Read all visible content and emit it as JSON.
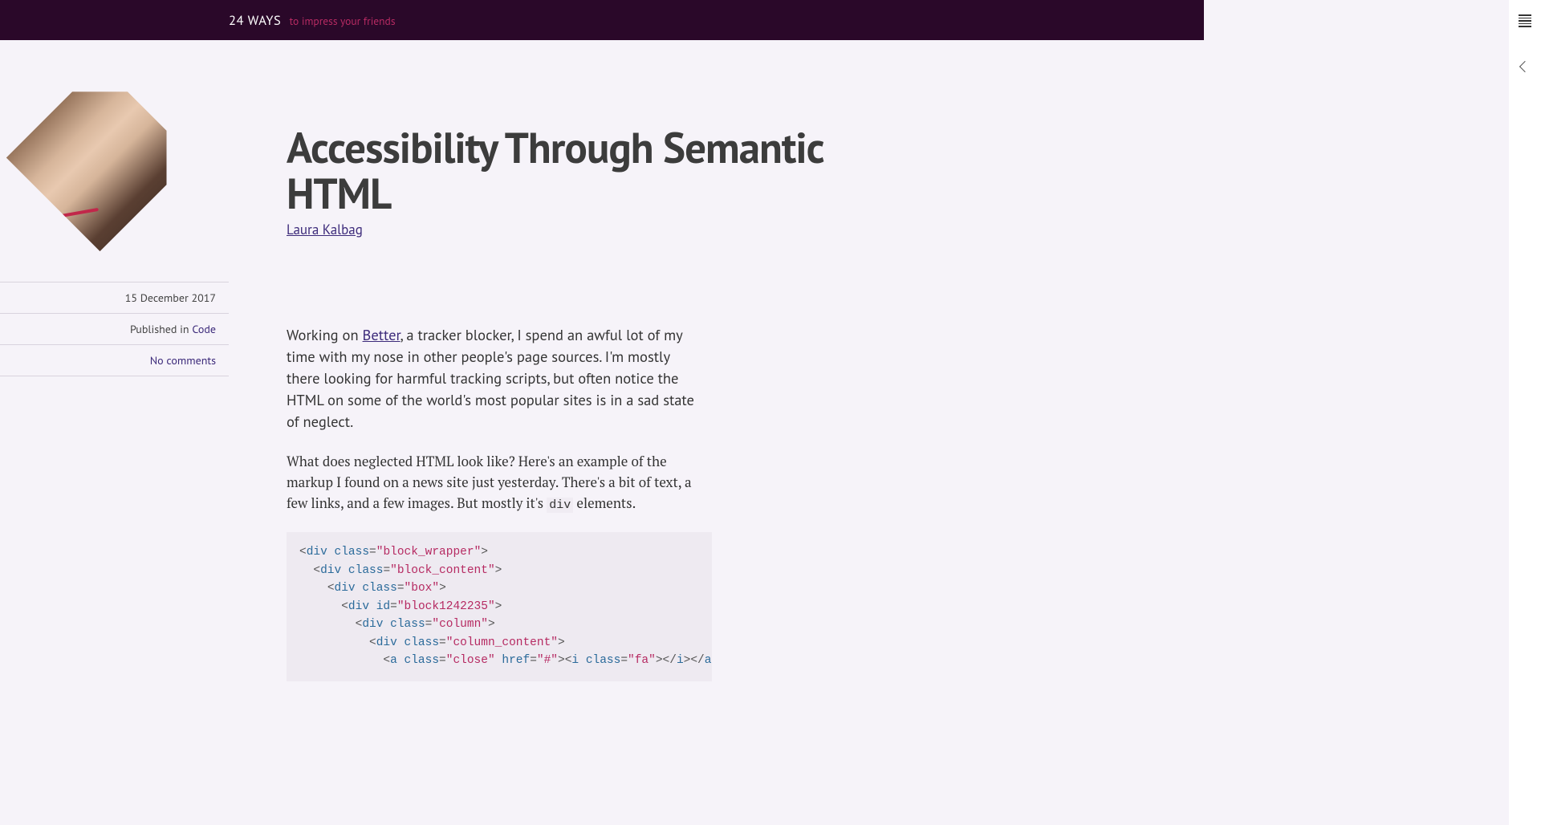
{
  "header": {
    "logo_bold": "24 WAYS",
    "logo_sub": "to impress your friends"
  },
  "meta": {
    "date": "15 December 2017",
    "published_prefix": "Published in ",
    "category": "Code",
    "comments": "No comments"
  },
  "article": {
    "title": "Accessibility Through Semantic HTML",
    "author": "Laura Kalbag",
    "intro_pre": "Working on ",
    "intro_link": "Better",
    "intro_post": ", a tracker blocker, I spend an awful lot of my time with my nose in other people's page sources. I'm mostly there looking for harmful track­ing scripts, but often notice the HTML on some of the world's most popular sites is in a sad state of neglect.",
    "p2_pre": "What does neglected HTML look like? Here's an example of the markup I found on a news site just yesterday. There's a bit of text, a few links, and a few images. But mostly it's ",
    "p2_code": "div",
    "p2_post": " elements."
  },
  "code": {
    "l1_str": "block_wrapper",
    "l2_str": "block_content",
    "l3_str": "box",
    "l4_str": "block1242235",
    "l5_str": "column",
    "l6_str": "column_content",
    "l7_str_close": "close",
    "l7_str_href": "#",
    "l7_str_fa": "fa"
  }
}
